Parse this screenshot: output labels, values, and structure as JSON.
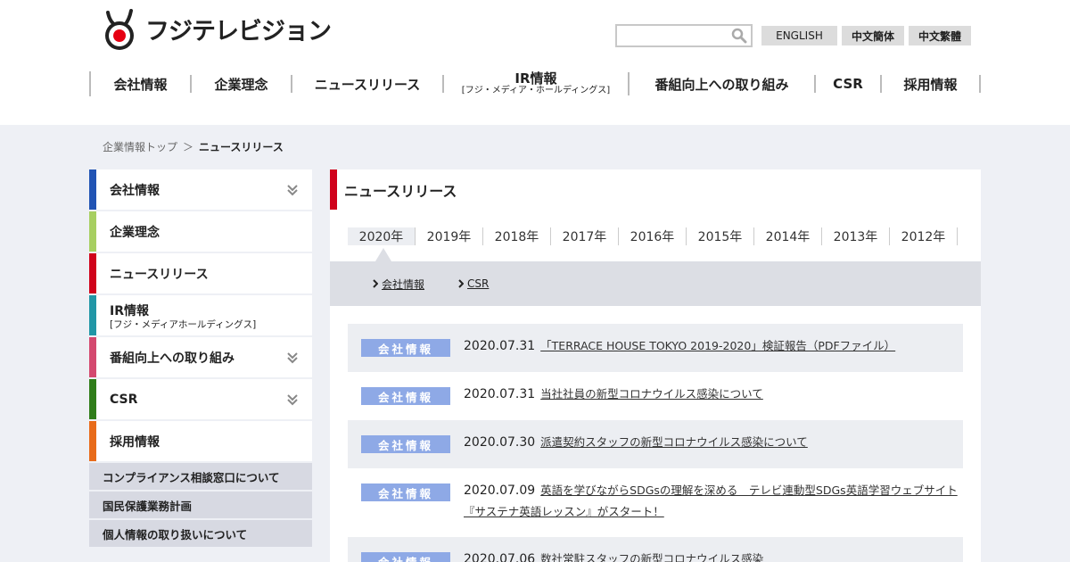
{
  "header": {
    "logo_text": "フジテレビジョン",
    "search_placeholder": "",
    "languages": [
      "ENGLISH",
      "中文簡体",
      "中文繁體"
    ]
  },
  "gnav": [
    {
      "label": "会社情報"
    },
    {
      "label": "企業理念"
    },
    {
      "label": "ニュースリリース"
    },
    {
      "label": "IR情報",
      "sub": "[フジ・メディア・ホールディングス]"
    },
    {
      "label": "番組向上への取り組み"
    },
    {
      "label": "CSR"
    },
    {
      "label": "採用情報"
    }
  ],
  "breadcrumb": {
    "parent": "企業情報トップ",
    "sep": "＞",
    "current": "ニュースリリース"
  },
  "sidebar": {
    "items": [
      {
        "label": "会社情報",
        "color": "#2154b4"
      },
      {
        "label": "企業理念",
        "color": "#a7cf61"
      },
      {
        "label": "ニュースリリース",
        "color": "#d0021b"
      },
      {
        "label": "IR情報",
        "sub": "[フジ・メディアホールディングス]",
        "color": "#2196a6"
      },
      {
        "label": "番組向上への取り組み",
        "color": "#d4496f"
      },
      {
        "label": "CSR",
        "color": "#2f7d1a"
      },
      {
        "label": "採用情報",
        "color": "#e86b1a"
      }
    ],
    "sub_items": [
      "コンプライアンス相談窓口について",
      "国民保護業務計画",
      "個人情報の取り扱いについて"
    ]
  },
  "content": {
    "title": "ニュースリリース",
    "years": [
      "2020年",
      "2019年",
      "2018年",
      "2017年",
      "2016年",
      "2015年",
      "2014年",
      "2013年",
      "2012年"
    ],
    "categories": [
      "会社情報",
      "CSR"
    ],
    "news": [
      {
        "tag": "会社情報",
        "date": "2020.07.31",
        "title": "「TERRACE HOUSE TOKYO 2019-2020」検証報告（PDFファイル）"
      },
      {
        "tag": "会社情報",
        "date": "2020.07.31",
        "title": "当社社員の新型コロナウイルス感染について"
      },
      {
        "tag": "会社情報",
        "date": "2020.07.30",
        "title": "派遣契約スタッフの新型コロナウイルス感染について"
      },
      {
        "tag": "会社情報",
        "date": "2020.07.09",
        "title": "英語を学びながらSDGsの理解を深める　テレビ連動型SDGs英語学習ウェブサイト",
        "title2": "『サステナ英語レッスン』がスタート！"
      },
      {
        "tag": "会社情報",
        "date": "2020.07.06",
        "title": "数社常駐スタッフの新型コロナウイルス感染"
      }
    ]
  },
  "colors": {
    "accent_red": "#d0021b",
    "tag_blue": "#8ea9e6",
    "bg_gray": "#eef0f5"
  }
}
